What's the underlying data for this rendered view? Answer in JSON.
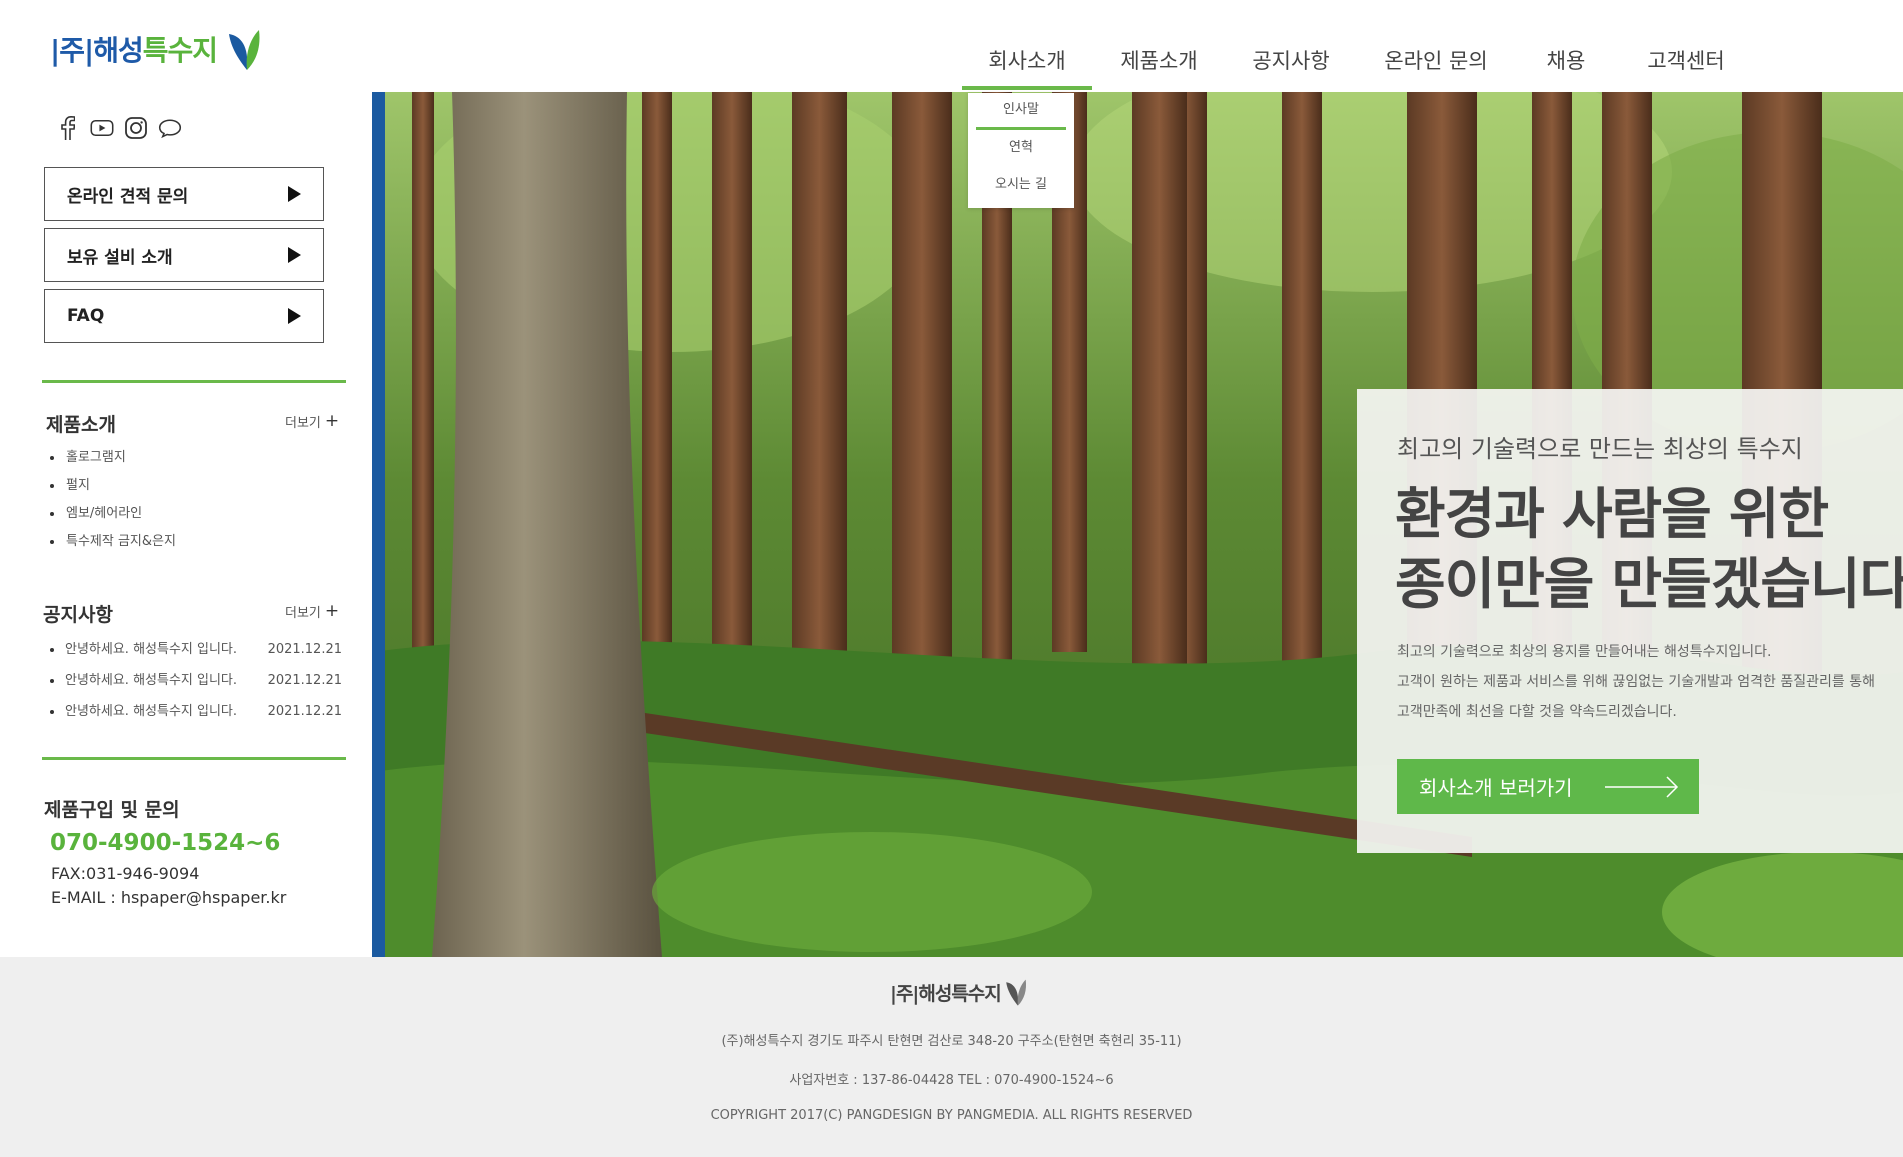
{
  "header": {
    "logo_prefix": "|주|",
    "logo_name_a": "해성",
    "logo_name_b": "특수지",
    "nav": [
      {
        "label": "회사소개"
      },
      {
        "label": "제품소개"
      },
      {
        "label": "공지사항"
      },
      {
        "label": "온라인 문의"
      },
      {
        "label": "채용"
      },
      {
        "label": "고객센터"
      }
    ],
    "dropdown": [
      "인사말",
      "연혁",
      "오시는 길"
    ]
  },
  "social_icons": [
    "facebook-icon",
    "youtube-icon",
    "instagram-icon",
    "chat-icon"
  ],
  "quick_links": [
    {
      "label": "온라인 견적 문의"
    },
    {
      "label": "보유 설비 소개"
    },
    {
      "label": "FAQ"
    }
  ],
  "products": {
    "title": "제품소개",
    "more": "더보기",
    "items": [
      "홀로그램지",
      "펄지",
      "엠보/헤어라인",
      "특수제작 금지&은지"
    ]
  },
  "notices": {
    "title": "공지사항",
    "more": "더보기",
    "items": [
      {
        "title": "안녕하세요. 해성특수지 입니다.",
        "date": "2021.12.21"
      },
      {
        "title": "안녕하세요. 해성특수지 입니다.",
        "date": "2021.12.21"
      },
      {
        "title": "안녕하세요. 해성특수지 입니다.",
        "date": "2021.12.21"
      }
    ]
  },
  "contact": {
    "title": "제품구입 및 문의",
    "phone": "070-4900-1524~6",
    "fax": "FAX:031-946-9094",
    "email": "E-MAIL : hspaper@hspaper.kr"
  },
  "hero": {
    "subtitle": "최고의 기술력으로 만드는 최상의 특수지",
    "headline_1": "환경과 사람을 위한",
    "headline_2": "종이만을 만들겠습니다.",
    "desc_1": "최고의 기술력으로 최상의 용지를 만들어내는 해성특수지입니다.",
    "desc_2": "고객이 원하는 제품과 서비스를 위해 끊임없는 기술개발과 엄격한 품질관리를 통해",
    "desc_3": "고객만족에 최선을 다할 것을 약속드리겠습니다.",
    "button": "회사소개 보러가기",
    "slides": 5,
    "active_slide": 1
  },
  "footer": {
    "logo_prefix": "|주|",
    "logo_name_a": "해성",
    "logo_name_b": "특수지",
    "address": "(주)해성특수지 경기도 파주시 탄현면 검산로 348-20 구주소(탄현면 축현리 35-11)",
    "biz": "사업자번호 : 137-86-04428 TEL : 070-4900-1524~6",
    "copyright": "COPYRIGHT 2017(C) PANGDESIGN BY PANGMEDIA. ALL RIGHTS RESERVED"
  },
  "colors": {
    "brand_blue": "#1b5aa0",
    "brand_green": "#5fb84a"
  }
}
